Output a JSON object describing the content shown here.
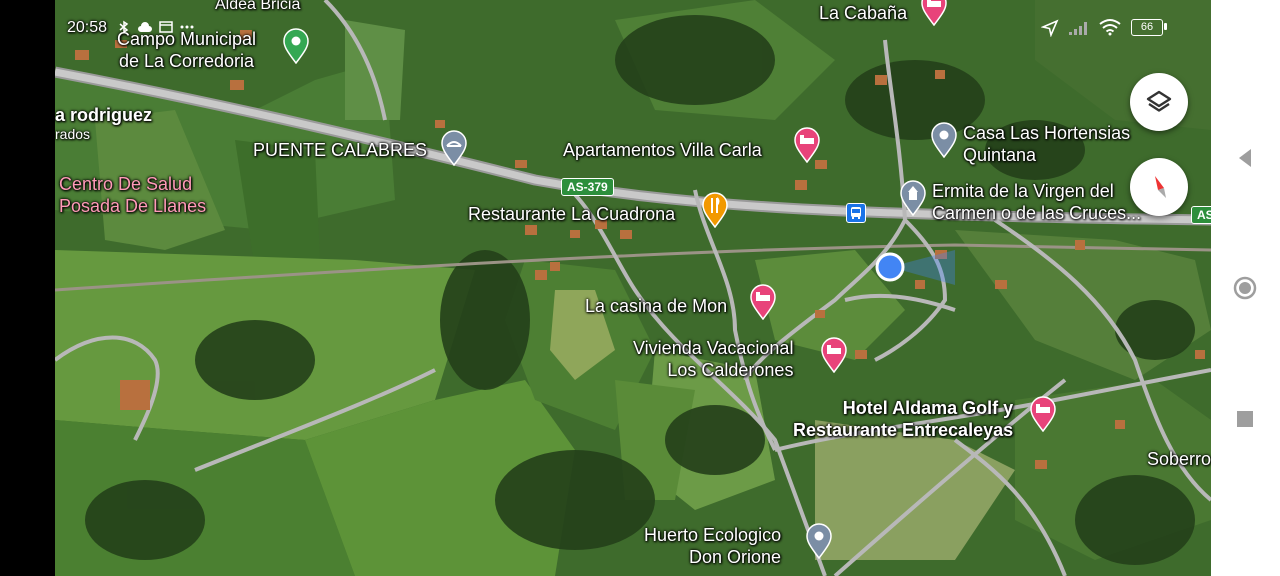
{
  "status": {
    "time": "20:58",
    "battery": "66"
  },
  "map": {
    "places": [
      {
        "id": "aldea-bricia",
        "name": "Aldea Bricia"
      },
      {
        "id": "campo-municipal",
        "name_line1": "Campo Municipal",
        "name_line2": "de La Corredoria"
      },
      {
        "id": "rodriguez",
        "name_line1": "a rodriguez",
        "name_line2": "rados"
      },
      {
        "id": "puente-calabres",
        "name": "PUENTE CALABRES"
      },
      {
        "id": "centro-salud",
        "name_line1": "Centro De Salud",
        "name_line2": "Posada De Llanes"
      },
      {
        "id": "restaurante-cuadrona",
        "name": "Restaurante La Cuadrona"
      },
      {
        "id": "villa-carla",
        "name": "Apartamentos Villa Carla"
      },
      {
        "id": "la-cabana",
        "name": "La Cabaña"
      },
      {
        "id": "casa-hortensias",
        "name_line1": "Casa Las Hortensias",
        "name_line2": "Quintana"
      },
      {
        "id": "ermita",
        "name_line1": "Ermita de la Virgen del",
        "name_line2": "Carmen o de las Cruces..."
      },
      {
        "id": "casina-mon",
        "name": "La casina de Mon"
      },
      {
        "id": "vivienda-vacacional",
        "name_line1": "Vivienda Vacacional",
        "name_line2": "Los Calderones"
      },
      {
        "id": "hotel-aldama",
        "name_line1": "Hotel Aldama Golf y",
        "name_line2": "Restaurante Entrecaleyas"
      },
      {
        "id": "soberron",
        "name": "Soberro"
      },
      {
        "id": "huerto",
        "name_line1": "Huerto Ecologico",
        "name_line2": "Don Orione"
      }
    ],
    "road_shields": [
      "AS-379",
      "AS"
    ],
    "colors": {
      "hotel_pin": "#e8437a",
      "food_pin": "#f29900",
      "place_pin": "#7b8ea5",
      "green_pin": "#34a853",
      "my_location": "#4285f4"
    }
  },
  "controls": {
    "layers_icon": "layers-icon",
    "compass_icon": "compass-icon"
  }
}
